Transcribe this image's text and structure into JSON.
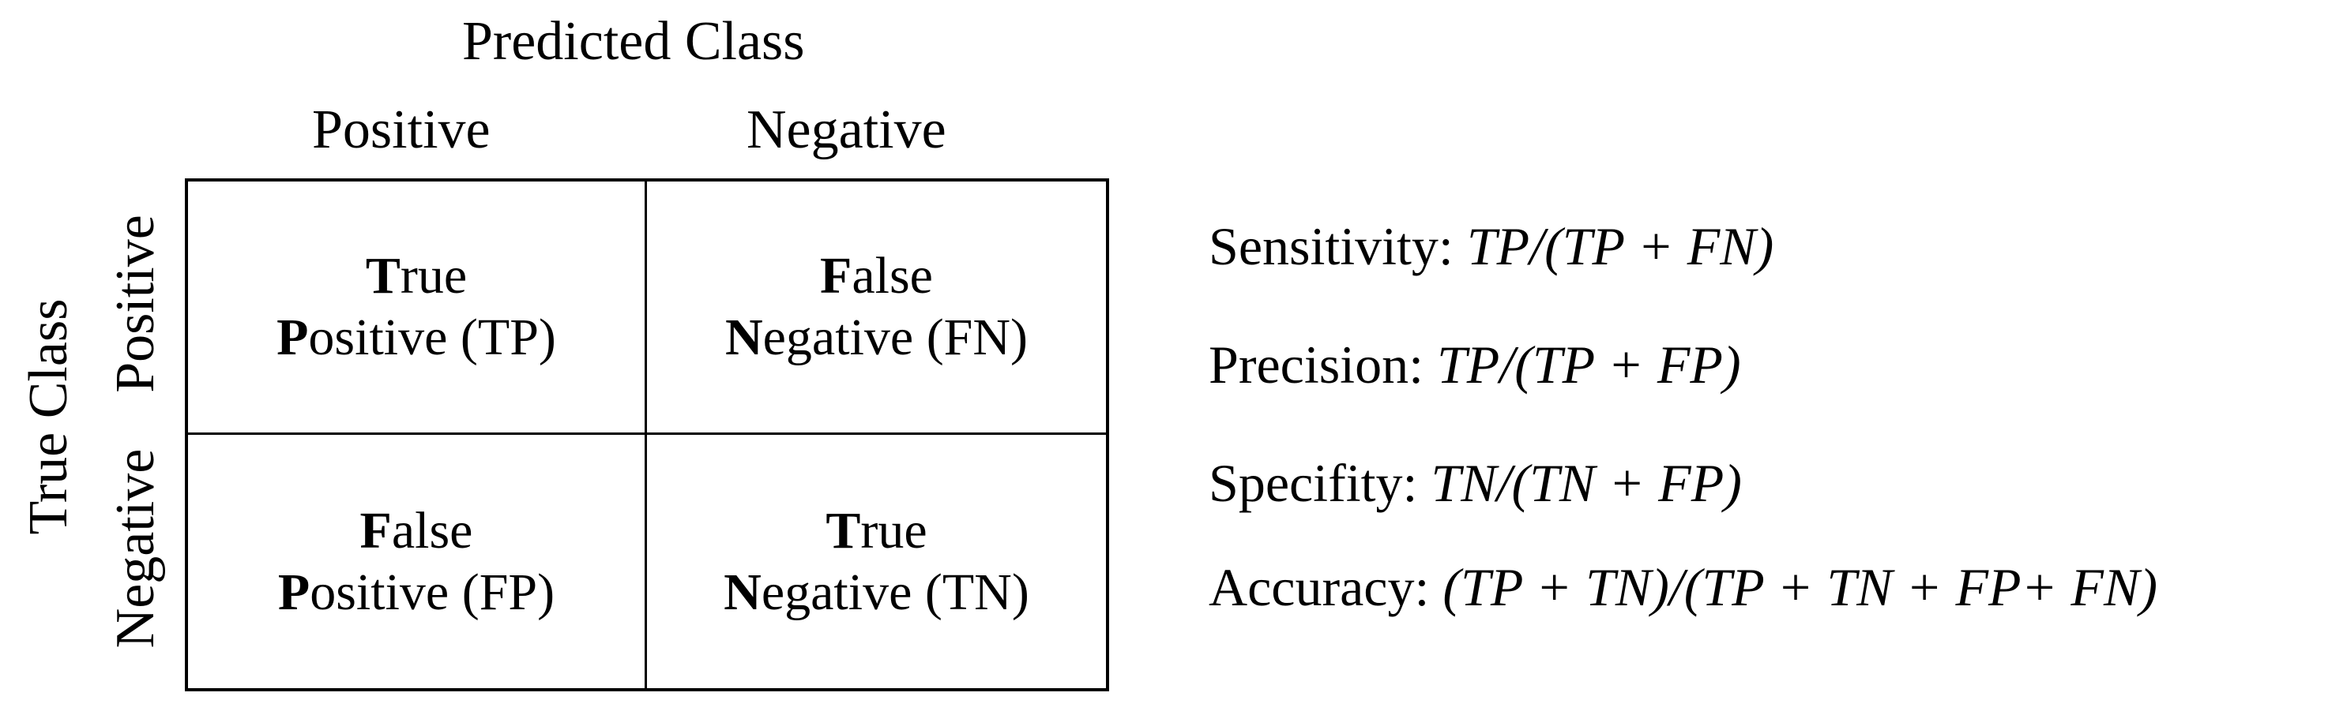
{
  "predicted_class_title": "Predicted Class",
  "true_class_title": "True Class",
  "columns": [
    "Positive",
    "Negative"
  ],
  "rows": [
    "Positive",
    "Negative"
  ],
  "cells": [
    {
      "first_initial": "T",
      "first_rest": "rue",
      "second_initial": "P",
      "second_rest": "ositive (TP)"
    },
    {
      "first_initial": "F",
      "first_rest": "alse",
      "second_initial": "N",
      "second_rest": "egative (FN)"
    },
    {
      "first_initial": "F",
      "first_rest": "alse",
      "second_initial": "P",
      "second_rest": "ositive (FP)"
    },
    {
      "first_initial": "T",
      "first_rest": "rue",
      "second_initial": "N",
      "second_rest": "egative (TN)"
    }
  ],
  "metrics": [
    {
      "label": "Sensitivity: ",
      "formula": "TP/(TP + FN)"
    },
    {
      "label": "Precision: ",
      "formula": "TP/(TP + FP)"
    },
    {
      "label": "Specifity: ",
      "formula": "TN/(TN + FP)"
    },
    {
      "label": "Accuracy: ",
      "formula": "(TP + TN)/(TP + TN + FP+ FN)"
    }
  ]
}
